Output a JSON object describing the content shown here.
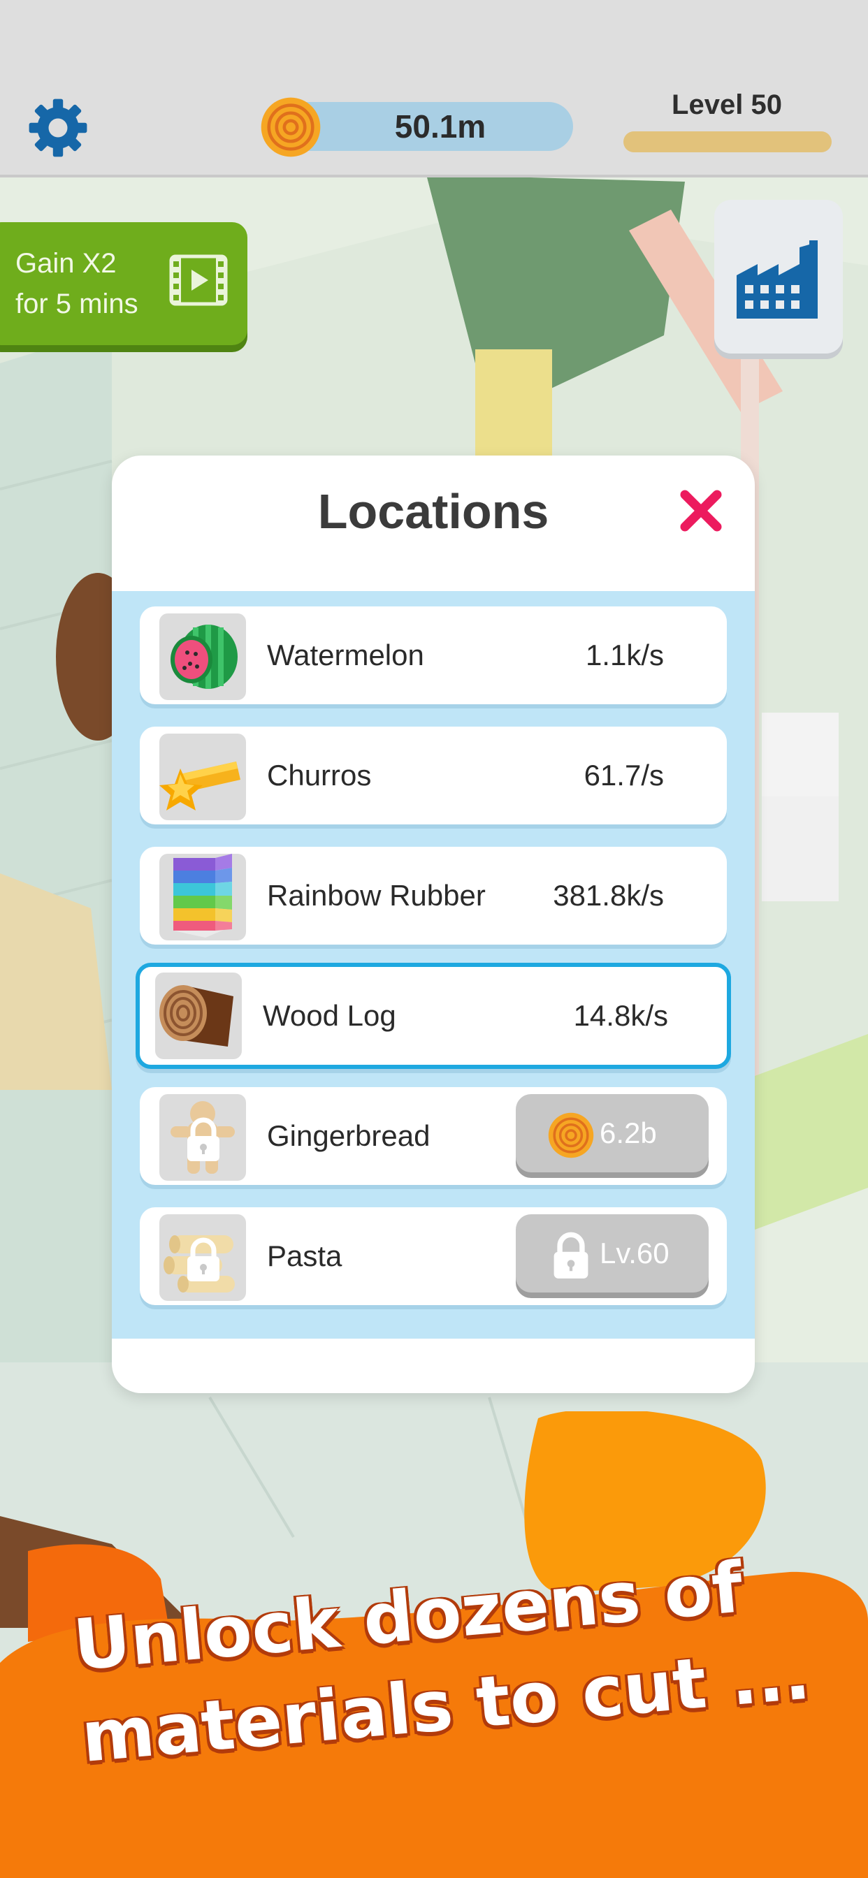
{
  "hud": {
    "settings_icon": "gear-icon",
    "coins": "50.1m",
    "coin_icon": "wood-coin-icon",
    "level": "Level 50"
  },
  "gain_button": {
    "line1": "Gain X2",
    "line2": "for 5 mins",
    "icon": "video-ad-icon"
  },
  "factory_button": {
    "icon": "factory-icon"
  },
  "modal": {
    "title": "Locations",
    "close_icon": "close-icon",
    "locations": [
      {
        "name": "Watermelon",
        "rate": "1.1k/s",
        "icon": "watermelon-icon",
        "selected": false
      },
      {
        "name": "Churros",
        "rate": "61.7/s",
        "icon": "churros-icon",
        "selected": false
      },
      {
        "name": "Rainbow Rubber",
        "rate": "381.8k/s",
        "icon": "rainbow-rubber-icon",
        "selected": false
      },
      {
        "name": "Wood Log",
        "rate": "14.8k/s",
        "icon": "wood-log-icon",
        "selected": true
      },
      {
        "name": "Gingerbread",
        "price": "6.2b",
        "icon": "gingerbread-icon",
        "locked": true
      },
      {
        "name": "Pasta",
        "required_level": "Lv.60",
        "icon": "pasta-icon",
        "locked": true
      }
    ]
  },
  "promo": {
    "line1": "Unlock dozens of",
    "line2": "materials to cut ..."
  },
  "colors": {
    "accent_blue": "#1ea8e0",
    "list_bg": "#bfe5f7",
    "gain_green": "#6fad1c",
    "promo_orange": "#f57a0a",
    "close_pink": "#ec1b5e"
  }
}
